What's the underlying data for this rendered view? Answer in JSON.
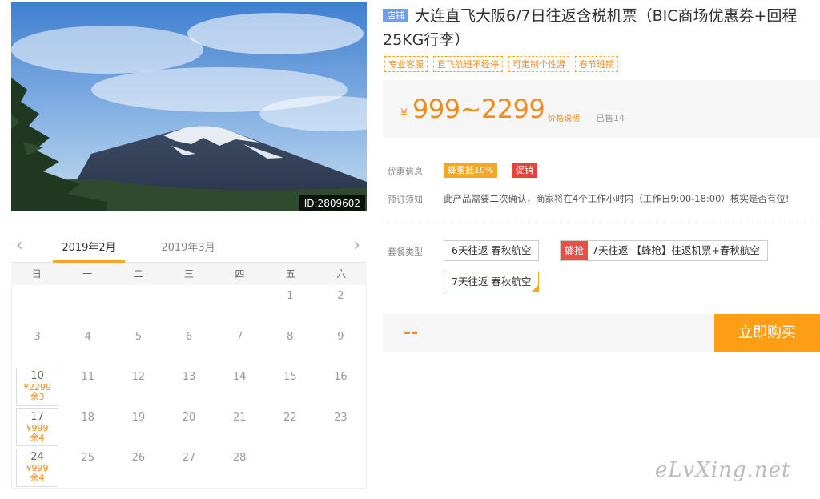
{
  "hero": {
    "id_label": "ID:2809602"
  },
  "calendar": {
    "months": [
      "2019年2月",
      "2019年3月"
    ],
    "weekdays": [
      "日",
      "一",
      "二",
      "三",
      "四",
      "五",
      "六"
    ],
    "cells": [
      {
        "d": ""
      },
      {
        "d": ""
      },
      {
        "d": ""
      },
      {
        "d": ""
      },
      {
        "d": ""
      },
      {
        "d": "1"
      },
      {
        "d": "2"
      },
      {
        "d": "3"
      },
      {
        "d": "4"
      },
      {
        "d": "5"
      },
      {
        "d": "6"
      },
      {
        "d": "7"
      },
      {
        "d": "8"
      },
      {
        "d": "9"
      },
      {
        "d": "10",
        "price": "¥2299",
        "rest": "余3"
      },
      {
        "d": "11"
      },
      {
        "d": "12"
      },
      {
        "d": "13"
      },
      {
        "d": "14"
      },
      {
        "d": "15"
      },
      {
        "d": "16"
      },
      {
        "d": "17",
        "price": "¥999",
        "rest": "余4"
      },
      {
        "d": "18"
      },
      {
        "d": "19"
      },
      {
        "d": "20"
      },
      {
        "d": "21"
      },
      {
        "d": "22"
      },
      {
        "d": "23"
      },
      {
        "d": "24",
        "price": "¥999",
        "rest": "余4"
      },
      {
        "d": "25"
      },
      {
        "d": "26"
      },
      {
        "d": "27"
      },
      {
        "d": "28"
      },
      {
        "d": ""
      },
      {
        "d": ""
      }
    ]
  },
  "product": {
    "shop_badge": "店铺",
    "title": "大连直飞大阪6/7日往返含税机票（BIC商场优惠券+回程25KG行李）",
    "tags": [
      "专业客服",
      "直飞航班不经停",
      "可定制个性游",
      "春节班期"
    ]
  },
  "price": {
    "currency": "¥",
    "range": "999~2299",
    "explain": "价格说明",
    "sold": "已售14"
  },
  "promo": {
    "label": "优惠信息",
    "badges": [
      "蜂蜜抵10%",
      "促销"
    ]
  },
  "notice": {
    "label": "预订须知",
    "text": "此产品需要二次确认，商家将在4个工作小时内（工作日9:00-18:00）核实是否有位!"
  },
  "packages": {
    "label": "套餐类型",
    "items": [
      {
        "flash": "",
        "text": "6天往返 春秋航空"
      },
      {
        "flash": "蜂抢",
        "text": "7天往返 【蜂抢】往返机票+春秋航空"
      },
      {
        "flash": "",
        "text": "7天往返 春秋航空"
      }
    ]
  },
  "buy": {
    "total": "--",
    "button": "立即购买"
  },
  "watermark": "eLvXing.net",
  "colors": {
    "accent": "#f5a623",
    "price": "#f08c1e",
    "sale": "#e8413e",
    "shop": "#6d9eeb"
  }
}
